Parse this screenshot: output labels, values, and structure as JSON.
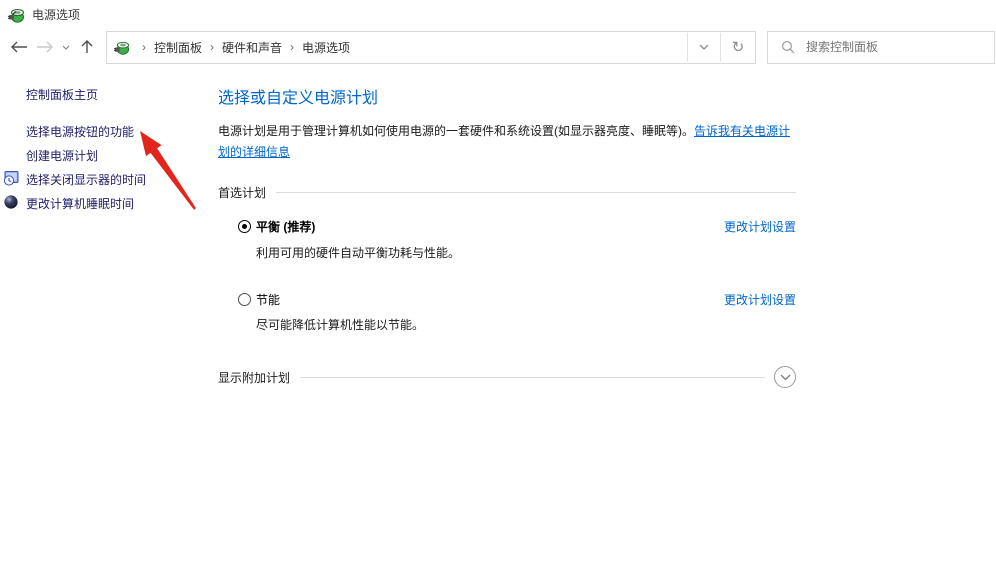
{
  "window": {
    "title": "电源选项"
  },
  "nav": {
    "back_icon": "left-arrow",
    "forward_icon": "right-arrow",
    "up_icon": "up-arrow",
    "breadcrumb": {
      "item1": "控制面板",
      "item2": "硬件和声音",
      "item3": "电源选项",
      "separator": "›"
    },
    "refresh_glyph": "↻",
    "search_placeholder": "搜索控制面板"
  },
  "sidebar": {
    "home": "控制面板主页",
    "task1": "选择电源按钮的功能",
    "task2": "创建电源计划",
    "task3": "选择关闭显示器的时间",
    "task4": "更改计算机睡眠时间"
  },
  "main": {
    "heading": "选择或自定义电源计划",
    "intro_text": "电源计划是用于管理计算机如何使用电源的一套硬件和系统设置(如显示器亮度、睡眠等)。",
    "learn_more_link": "告诉我有关电源计划的详细信息",
    "section_title": "首选计划",
    "plans": {
      "0": {
        "name": "平衡 (推荐)",
        "selected": "true",
        "description": "利用可用的硬件自动平衡功耗与性能。",
        "link": "更改计划设置"
      },
      "1": {
        "name": "节能",
        "selected": "false",
        "description": "尽可能降低计算机性能以节能。",
        "link": "更改计划设置"
      }
    },
    "show_additional_plans": "显示附加计划"
  },
  "annotation": {
    "arrow_color": "#e3261d",
    "arrow_points_to": "选择电源按钮的功能"
  },
  "colors": {
    "accent_blue": "#0066cc",
    "sidebar_link": "#21216b",
    "border_gray": "#d9d9d9"
  }
}
